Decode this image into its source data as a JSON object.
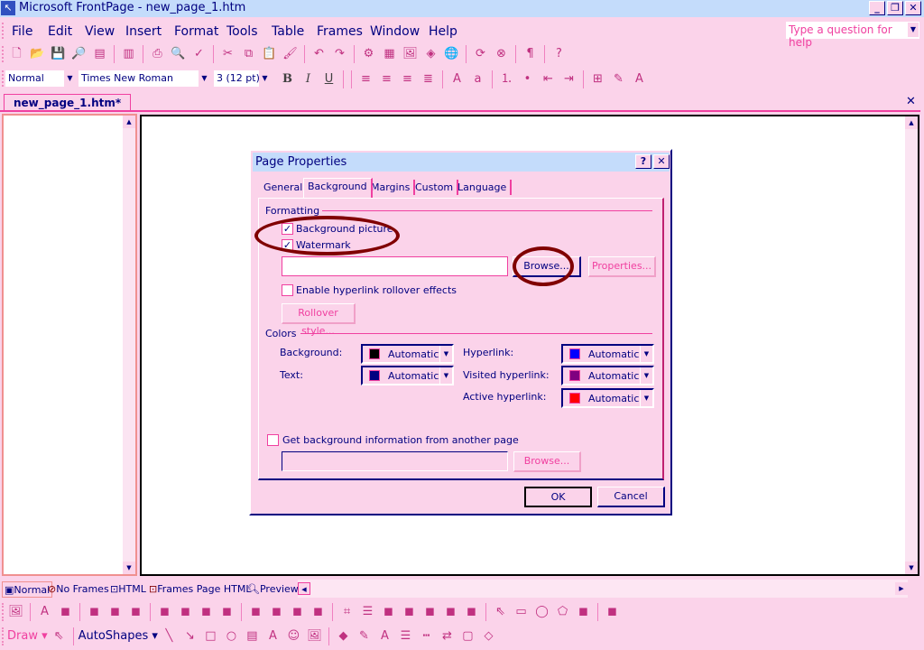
{
  "window": {
    "title": "Microsoft FrontPage - new_page_1.htm",
    "minimize": "_",
    "restore": "❐",
    "close": "✕"
  },
  "menu": [
    {
      "label": "File"
    },
    {
      "label": "Edit"
    },
    {
      "label": "View"
    },
    {
      "label": "Insert"
    },
    {
      "label": "Format"
    },
    {
      "label": "Tools"
    },
    {
      "label": "Table"
    },
    {
      "label": "Frames"
    },
    {
      "label": "Window"
    },
    {
      "label": "Help"
    }
  ],
  "help_box": {
    "placeholder": "Type a question for help"
  },
  "standard_toolbar": [
    "new-page-icon",
    "open-icon",
    "save-icon",
    "search-icon",
    "publish-icon",
    "folder-list-icon",
    "print-icon",
    "preview-icon",
    "spelling-icon",
    "cut-icon",
    "copy-icon",
    "paste-icon",
    "format-painter-icon",
    "undo-icon",
    "redo-icon",
    "web-component-icon",
    "insert-table-icon",
    "insert-picture-icon",
    "drawing-icon",
    "hyperlink-icon",
    "refresh-icon",
    "stop-icon",
    "show-all-icon",
    "help-icon"
  ],
  "formatting": {
    "style": "Normal",
    "font": "Times New Roman",
    "size": "3  (12 pt)",
    "bold": "B",
    "italic": "I",
    "underline": "U"
  },
  "formatting_icons": [
    "align-left-icon",
    "center-icon",
    "align-right-icon",
    "justify-icon",
    "increase-font-icon",
    "decrease-font-icon",
    "numbering-icon",
    "bullets-icon",
    "decrease-indent-icon",
    "increase-indent-icon",
    "borders-icon",
    "highlight-icon",
    "font-color-icon"
  ],
  "document_tab": {
    "label": "new_page_1.htm*",
    "close": "✕"
  },
  "view_tabs": [
    {
      "label": "Normal"
    },
    {
      "label": "No Frames"
    },
    {
      "label": "HTML"
    },
    {
      "label": "Frames Page HTML"
    },
    {
      "label": "Preview"
    }
  ],
  "pictures_toolbar": [
    "insert-picture-icon",
    "text-icon",
    "auto-thumbnail-icon",
    "position-absolute-icon",
    "bring-forward-icon",
    "send-backward-icon",
    "rotate-left-icon",
    "rotate-right-icon",
    "flip-horizontal-icon",
    "flip-vertical-icon",
    "more-contrast-icon",
    "less-contrast-icon",
    "more-brightness-icon",
    "less-brightness-icon",
    "crop-icon",
    "line-style-icon",
    "format-picture-icon",
    "color-icon",
    "bevel-icon",
    "resample-icon",
    "reset-icon",
    "select-icon",
    "rectangle-hotspot-icon",
    "circle-hotspot-icon",
    "polygon-hotspot-icon",
    "highlight-hotspots-icon",
    "restore-icon"
  ],
  "drawing_toolbar": {
    "draw": "Draw ▾",
    "autoshapes": "AutoShapes ▾",
    "icons": [
      "line-icon",
      "arrow-icon",
      "rectangle-icon",
      "oval-icon",
      "textbox-icon",
      "wordart-icon",
      "clipart-icon",
      "picture-icon",
      "fill-color-icon",
      "line-color-icon",
      "font-color-icon",
      "line-style-icon",
      "dash-style-icon",
      "arrow-style-icon",
      "shadow-icon",
      "3d-icon"
    ]
  },
  "dialog": {
    "title": "Page Properties",
    "help": "?",
    "close": "✕",
    "tabs": [
      {
        "label": "General"
      },
      {
        "label": "Background"
      },
      {
        "label": "Margins"
      },
      {
        "label": "Custom"
      },
      {
        "label": "Language"
      }
    ],
    "active_tab": "Background",
    "formatting_group": "Formatting",
    "background_picture": {
      "label": "Background picture",
      "checked": true
    },
    "watermark": {
      "label": "Watermark",
      "checked": true
    },
    "picture_path": "",
    "browse": "Browse...",
    "properties": "Properties...",
    "rollover": {
      "label": "Enable hyperlink rollover effects",
      "checked": false
    },
    "rollover_style": "Rollover style...",
    "colors_group": "Colors",
    "colors": {
      "background": {
        "label": "Background:",
        "value": "Automatic",
        "swatch": "#000000"
      },
      "text": {
        "label": "Text:",
        "value": "Automatic",
        "swatch": "#000080"
      },
      "hyperlink": {
        "label": "Hyperlink:",
        "value": "Automatic",
        "swatch": "#0000ff"
      },
      "visited": {
        "label": "Visited hyperlink:",
        "value": "Automatic",
        "swatch": "#800080"
      },
      "active": {
        "label": "Active hyperlink:",
        "value": "Automatic",
        "swatch": "#ff0000"
      }
    },
    "get_background": {
      "label": "Get background information from another page",
      "checked": false
    },
    "browse2": "Browse...",
    "ok": "OK",
    "cancel": "Cancel"
  }
}
